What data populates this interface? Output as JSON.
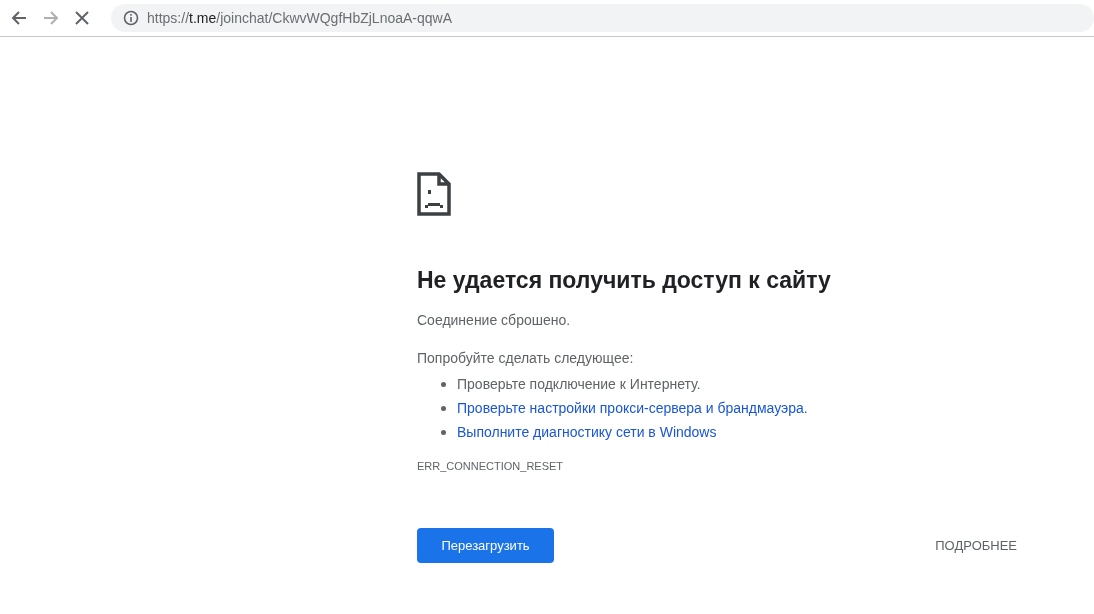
{
  "toolbar": {
    "back": {
      "disabled": false
    },
    "forward": {
      "disabled": true
    },
    "stop": {
      "disabled": false
    },
    "url": {
      "scheme": "https://",
      "host": "t.me",
      "path": "/joinchat/CkwvWQgfHbZjLnoaA-qqwA"
    }
  },
  "error": {
    "title": "Не удается получить доступ к сайту",
    "message": "Соединение сброшено.",
    "suggestions_heading": "Попробуйте сделать следующее:",
    "suggestions": [
      {
        "kind": "text",
        "text": "Проверьте подключение к Интернету."
      },
      {
        "kind": "link",
        "text": "Проверьте настройки прокси-сервера и брандмауэра."
      },
      {
        "kind": "link",
        "text": "Выполните диагностику сети в Windows"
      }
    ],
    "code": "ERR_CONNECTION_RESET",
    "reload_button": "Перезагрузить",
    "details_button": "ПОДРОБНЕЕ"
  }
}
